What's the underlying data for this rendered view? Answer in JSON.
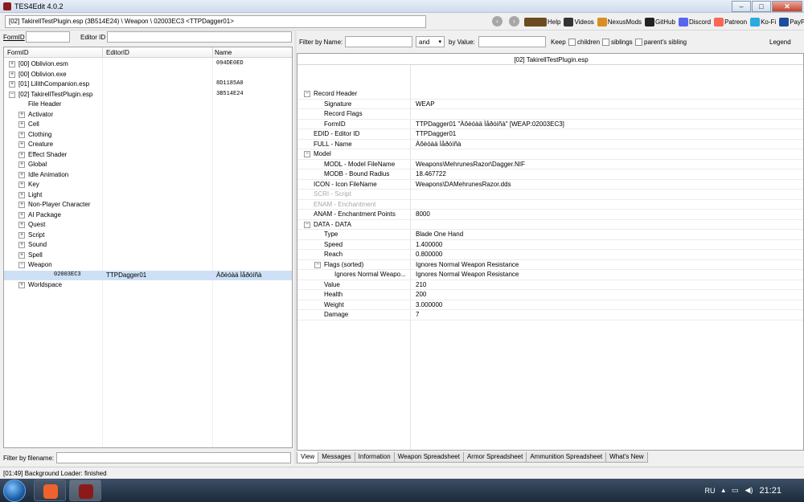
{
  "window": {
    "title": "TES4Edit 4.0.2"
  },
  "pathbar": {
    "path": "[02] TakirellTestPlugin.esp (3B514E24) \\ Weapon \\ 02003EC3 <TTPDagger01>"
  },
  "links": [
    {
      "label": "Help",
      "icon": "book-icon",
      "color": "#6b4b1f"
    },
    {
      "label": "Videos",
      "icon": "video-icon",
      "color": "#333333"
    },
    {
      "label": "NexusMods",
      "icon": "nexus-icon",
      "color": "#d98f1f"
    },
    {
      "label": "GitHub",
      "icon": "github-icon",
      "color": "#222222"
    },
    {
      "label": "Discord",
      "icon": "discord-icon",
      "color": "#5865f2"
    },
    {
      "label": "Patreon",
      "icon": "patreon-icon",
      "color": "#f96854"
    },
    {
      "label": "Ko-Fi",
      "icon": "kofi-icon",
      "color": "#29abe0"
    },
    {
      "label": "PayPal",
      "icon": "paypal-icon",
      "color": "#1a4e9c"
    }
  ],
  "left": {
    "formid_label": "FormID",
    "editorid_label": "Editor ID",
    "columns": [
      "FormID",
      "EditorID",
      "Name"
    ],
    "rows": [
      {
        "label": "[00] Oblivion.esm",
        "c2": "",
        "c3": "094DE0ED",
        "level": 0,
        "expander": "+"
      },
      {
        "label": "[00] Oblivion.exe",
        "c2": "",
        "c3": "",
        "level": 0,
        "expander": "+"
      },
      {
        "label": "[01] LilithCompanion.esp",
        "c2": "",
        "c3": "8D1185A0",
        "level": 0,
        "expander": "+"
      },
      {
        "label": "[02] TakirellTestPlugin.esp",
        "c2": "",
        "c3": "3B514E24",
        "level": 0,
        "expander": "-"
      },
      {
        "label": "File Header",
        "c2": "",
        "c3": "",
        "level": 1,
        "expander": ""
      },
      {
        "label": "Activator",
        "c2": "",
        "c3": "",
        "level": 1,
        "expander": "+"
      },
      {
        "label": "Cell",
        "c2": "",
        "c3": "",
        "level": 1,
        "expander": "+"
      },
      {
        "label": "Clothing",
        "c2": "",
        "c3": "",
        "level": 1,
        "expander": "+"
      },
      {
        "label": "Creature",
        "c2": "",
        "c3": "",
        "level": 1,
        "expander": "+"
      },
      {
        "label": "Effect Shader",
        "c2": "",
        "c3": "",
        "level": 1,
        "expander": "+"
      },
      {
        "label": "Global",
        "c2": "",
        "c3": "",
        "level": 1,
        "expander": "+"
      },
      {
        "label": "Idle Animation",
        "c2": "",
        "c3": "",
        "level": 1,
        "expander": "+"
      },
      {
        "label": "Key",
        "c2": "",
        "c3": "",
        "level": 1,
        "expander": "+"
      },
      {
        "label": "Light",
        "c2": "",
        "c3": "",
        "level": 1,
        "expander": "+"
      },
      {
        "label": "Non-Player Character",
        "c2": "",
        "c3": "",
        "level": 1,
        "expander": "+"
      },
      {
        "label": "AI Package",
        "c2": "",
        "c3": "",
        "level": 1,
        "expander": "+"
      },
      {
        "label": "Quest",
        "c2": "",
        "c3": "",
        "level": 1,
        "expander": "+"
      },
      {
        "label": "Script",
        "c2": "",
        "c3": "",
        "level": 1,
        "expander": "+"
      },
      {
        "label": "Sound",
        "c2": "",
        "c3": "",
        "level": 1,
        "expander": "+"
      },
      {
        "label": "Spell",
        "c2": "",
        "c3": "",
        "level": 1,
        "expander": "+"
      },
      {
        "label": "Weapon",
        "c2": "",
        "c3": "",
        "level": 1,
        "expander": "-"
      },
      {
        "label": "02003EC3",
        "c2": "TTPDagger01",
        "c3": "Àõèóàä Ìåðóíñà",
        "level": 2,
        "expander": "",
        "selected": true
      },
      {
        "label": "Worldspace",
        "c2": "",
        "c3": "",
        "level": 1,
        "expander": "+"
      }
    ],
    "filename_filter_label": "Filter by filename:"
  },
  "right": {
    "filter_by_name_label": "Filter by Name:",
    "and_option": "and",
    "by_value_label": "by Value:",
    "keep_label": "Keep",
    "children_label": "children",
    "siblings_label": "siblings",
    "parents_sibling_label": "parent's sibling",
    "legend_label": "Legend",
    "column_header": "[02] TakirellTestPlugin.esp",
    "rows": [
      {
        "key": "Record Header",
        "value": "",
        "level": 0,
        "expander": "-"
      },
      {
        "key": "Signature",
        "value": "WEAP",
        "level": 1,
        "expander": ""
      },
      {
        "key": "Record Flags",
        "value": "",
        "level": 1,
        "expander": ""
      },
      {
        "key": "FormID",
        "value": "TTPDagger01 \"Àõèóàä Ìåðóíñà\" [WEAP:02003EC3]",
        "level": 1,
        "expander": ""
      },
      {
        "key": "EDID - Editor ID",
        "value": "TTPDagger01",
        "level": 0,
        "expander": ""
      },
      {
        "key": "FULL - Name",
        "value": "Àõèóàä Ìåðóíñà",
        "level": 0,
        "expander": ""
      },
      {
        "key": "Model",
        "value": "",
        "level": 0,
        "expander": "-"
      },
      {
        "key": "MODL - Model FileName",
        "value": "Weapons\\MehrunesRazor\\Dagger.NIF",
        "level": 1,
        "expander": ""
      },
      {
        "key": "MODB - Bound Radius",
        "value": "18.467722",
        "level": 1,
        "expander": ""
      },
      {
        "key": "ICON - Icon FileName",
        "value": "Weapons\\DAMehrunesRazor.dds",
        "level": 0,
        "expander": ""
      },
      {
        "key": "SCRI - Script",
        "value": "",
        "level": 0,
        "expander": "",
        "dim": true
      },
      {
        "key": "ENAM - Enchantment",
        "value": "",
        "level": 0,
        "expander": "",
        "dim": true
      },
      {
        "key": "ANAM - Enchantment Points",
        "value": "8000",
        "level": 0,
        "expander": ""
      },
      {
        "key": "DATA - DATA",
        "value": "",
        "level": 0,
        "expander": "-"
      },
      {
        "key": "Type",
        "value": "Blade One Hand",
        "level": 1,
        "expander": ""
      },
      {
        "key": "Speed",
        "value": "1.400000",
        "level": 1,
        "expander": ""
      },
      {
        "key": "Reach",
        "value": "0.800000",
        "level": 1,
        "expander": ""
      },
      {
        "key": "Flags (sorted)",
        "value": "Ignores Normal Weapon Resistance",
        "level": 1,
        "expander": "-"
      },
      {
        "key": "Ignores Normal Weapo...",
        "value": "Ignores Normal Weapon Resistance",
        "level": 2,
        "expander": ""
      },
      {
        "key": "Value",
        "value": "210",
        "level": 1,
        "expander": ""
      },
      {
        "key": "Health",
        "value": "200",
        "level": 1,
        "expander": ""
      },
      {
        "key": "Weight",
        "value": "3.000000",
        "level": 1,
        "expander": ""
      },
      {
        "key": "Damage",
        "value": "7",
        "level": 1,
        "expander": ""
      }
    ],
    "tabs": [
      "View",
      "Messages",
      "Information",
      "Weapon Spreadsheet",
      "Armor Spreadsheet",
      "Ammunition Spreadsheet",
      "What's New"
    ]
  },
  "status": {
    "text": "[01:49] Background Loader: finished"
  },
  "taskbar": {
    "lang": "RU",
    "time": "21:21"
  }
}
